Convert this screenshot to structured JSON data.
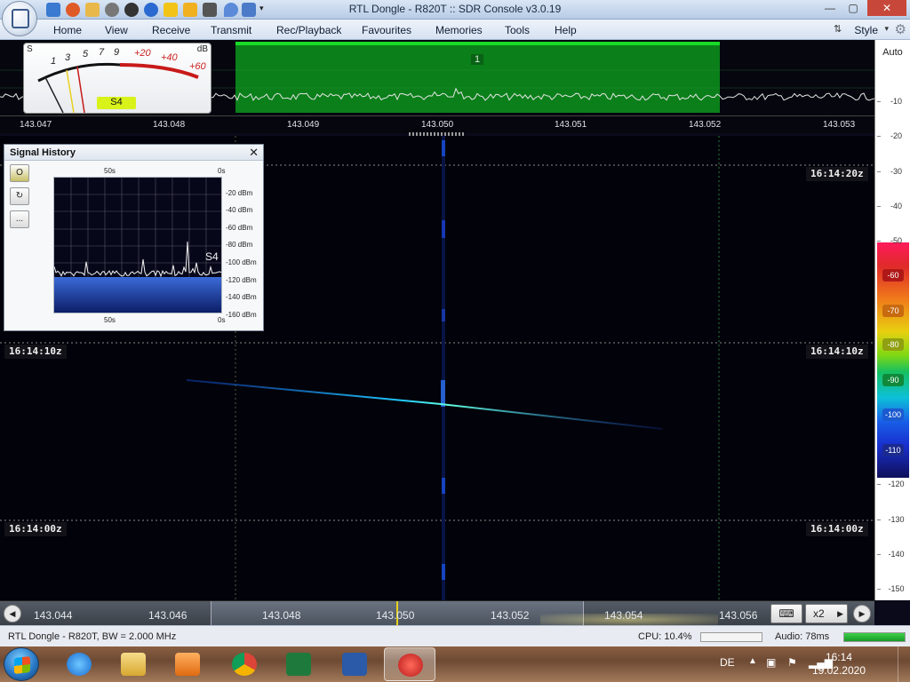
{
  "window": {
    "title": "RTL Dongle - R820T :: SDR Console v3.0.19"
  },
  "menu": {
    "items": [
      "Home",
      "View",
      "Receive",
      "Transmit",
      "Rec/Playback",
      "Favourites",
      "Memories",
      "Tools",
      "Help"
    ],
    "style_label": "Style"
  },
  "smeter": {
    "s_label": "S",
    "db_label": "dB",
    "scale_s": [
      "1",
      "3",
      "5",
      "7",
      "9"
    ],
    "scale_red": [
      "+20",
      "+40",
      "+60"
    ],
    "reading": "S4"
  },
  "spectrum": {
    "band_label": "1",
    "freq_ticks": [
      "143.047",
      "143.048",
      "143.049",
      "143.050",
      "143.051",
      "143.052",
      "143.053"
    ]
  },
  "right_scale": {
    "auto_label": "Auto",
    "ticks": [
      "-10",
      "-20",
      "-30",
      "-40",
      "-50",
      "-60",
      "-70",
      "-80",
      "-90",
      "-100",
      "-110",
      "-120",
      "-130",
      "-140",
      "-150"
    ]
  },
  "colorbar": {
    "labels": [
      "-60",
      "-70",
      "-80",
      "-90",
      "-100",
      "-110"
    ]
  },
  "waterfall": {
    "timestamps_right": [
      "16:14:20z",
      "16:14:10z",
      "16:14:00z"
    ],
    "timestamps_left": [
      "16:14:10z",
      "16:14:00z"
    ]
  },
  "signal_history": {
    "title": "Signal History",
    "close": "✕",
    "time_top_left": "50s",
    "time_top_right": "0s",
    "time_bottom_left": "50s",
    "time_bottom_right": "0s",
    "y_labels": [
      "-20 dBm",
      "-40 dBm",
      "-60 dBm",
      "-80 dBm",
      "-100 dBm",
      "-120 dBm",
      "-140 dBm",
      "-160 dBm"
    ],
    "s_reading": "S4",
    "tool_buttons": [
      "O",
      "↻",
      "..."
    ]
  },
  "freq_bar": {
    "labels": [
      "143.044",
      "143.046",
      "143.048",
      "143.050",
      "143.052",
      "143.054",
      "143.056"
    ],
    "zoom_label": "x2"
  },
  "status": {
    "device": "RTL Dongle - R820T, BW = 2.000 MHz",
    "cpu": "CPU: 10.4%",
    "audio": "Audio: 78ms",
    "cpu_fill": 0.0,
    "audio_fill": 1.0
  },
  "taskbar": {
    "language": "DE",
    "time": "16:14",
    "date": "19.02.2020"
  }
}
